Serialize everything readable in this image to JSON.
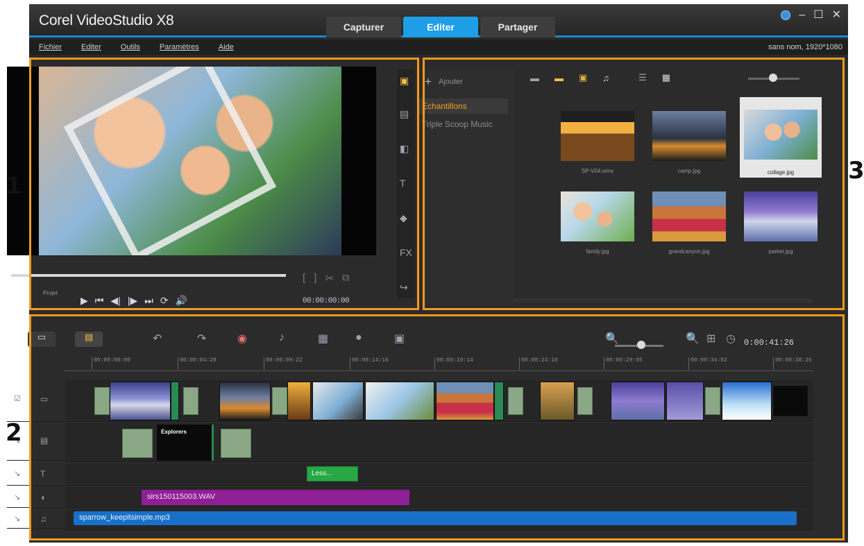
{
  "app": {
    "title": "Corel VideoStudio X8",
    "project_info": "sans nom, 1920*1080"
  },
  "nav": {
    "capture": "Capturer",
    "edit": "Editer",
    "share": "Partager",
    "active": "Editer"
  },
  "window_controls": {
    "minimize": "–",
    "maximize": "☐",
    "close": "✕"
  },
  "menu": {
    "items": [
      "Fichier",
      "Editer",
      "Outils",
      "Paramètres",
      "Aide"
    ]
  },
  "callouts": {
    "player": "1",
    "timeline": "2",
    "library": "3"
  },
  "player": {
    "project_label": "Projet",
    "timecode": "00:00:00:00",
    "transport": {
      "play": "▶",
      "home": "⏮",
      "prev": "◀|",
      "next": "|▶",
      "end": "⏭",
      "repeat": "⟳",
      "volume": "🔊"
    }
  },
  "library": {
    "add_label": "Ajouter",
    "folders": [
      "Echantillons",
      "Triple Scoop Music"
    ],
    "selected_folder": "Echantillons",
    "thumbnails": [
      {
        "caption": "SP-V04.wmv",
        "selected": false
      },
      {
        "caption": "camp.jpg",
        "selected": false
      },
      {
        "caption": "collage.jpg",
        "selected": true
      },
      {
        "caption": "family.jpg",
        "selected": false
      },
      {
        "caption": "grandcanyon.jpg",
        "selected": false
      },
      {
        "caption": "parker.jpg",
        "selected": false
      }
    ]
  },
  "timeline": {
    "duration": "0:00:41:26",
    "ruler": [
      "00:00:00:00",
      "00:00:04:28",
      "00:00:09:22",
      "00:00:14:16",
      "00:00:19:14",
      "00:00:24:10",
      "00:00:29:05",
      "00:00:34:02",
      "00:00:38:26"
    ],
    "title_clip": "Explorers",
    "text_clip": "Less...",
    "voice_clip": "sirs150115003.WAV",
    "music_clip": "sparrow_keepitsimple.mp3"
  },
  "colors": {
    "accent": "#1e9ee6",
    "highlight": "#f39a1e",
    "voice": "#8f1f95",
    "music": "#1870c8",
    "text_clip": "#28a845"
  }
}
